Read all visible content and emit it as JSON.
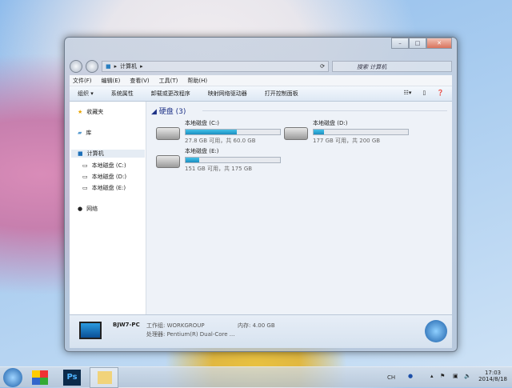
{
  "window": {
    "controls": [
      "minimize",
      "maximize",
      "close"
    ],
    "address": [
      "计算机"
    ],
    "search_placeholder": "搜索 计算机"
  },
  "menu": [
    "文件(F)",
    "编辑(E)",
    "查看(V)",
    "工具(T)",
    "帮助(H)"
  ],
  "toolbar": {
    "items": [
      "组织 ▾",
      "系统属性",
      "卸载或更改程序",
      "映射网络驱动器",
      "打开控制面板"
    ]
  },
  "sidebar": {
    "favorites": "收藏夹",
    "libraries": "库",
    "computer": "计算机",
    "drives": [
      "本地磁盘 (C:)",
      "本地磁盘 (D:)",
      "本地磁盘 (E:)"
    ],
    "network": "网络"
  },
  "group": {
    "title": "硬盘 (3)"
  },
  "drives": [
    {
      "name": "本地磁盘 (C:)",
      "info": "27.8 GB 可用，共 60.0 GB",
      "used_pct": 54
    },
    {
      "name": "本地磁盘 (D:)",
      "info": "177 GB 可用，共 200 GB",
      "used_pct": 11
    },
    {
      "name": "本地磁盘 (E:)",
      "info": "151 GB 可用，共 175 GB",
      "used_pct": 14
    }
  ],
  "details": {
    "pc": "BJW7-PC",
    "workgroup": "工作组: WORKGROUP",
    "memory": "内存: 4.00 GB",
    "cpu": "处理器: Pentium(R) Dual-Core ..."
  },
  "taskbar": {
    "ps": "Ps",
    "ime": "CH",
    "time": "17:03",
    "date": "2014/8/18"
  }
}
